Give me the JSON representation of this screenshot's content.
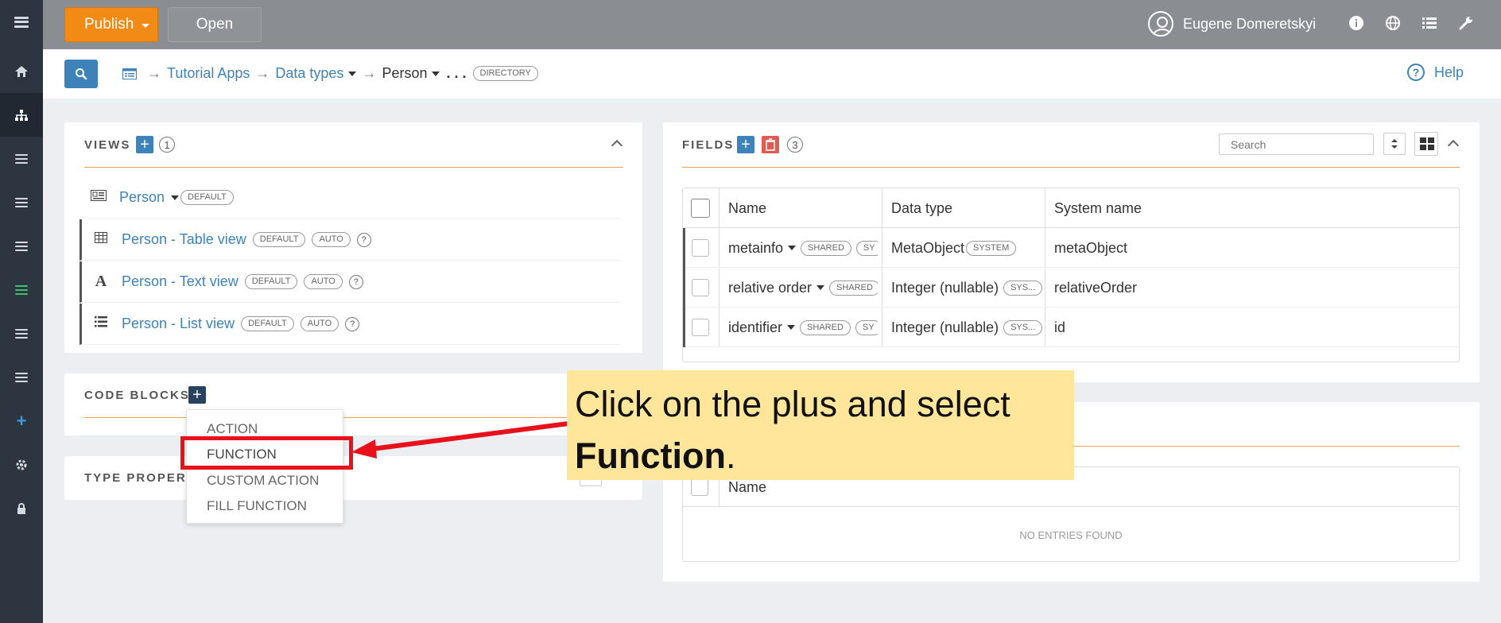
{
  "sidebar": {
    "items": [
      {
        "icon": "menu-icon"
      },
      {
        "icon": "home-icon"
      },
      {
        "icon": "sitemap-icon"
      },
      {
        "icon": "list-icon"
      },
      {
        "icon": "list-icon"
      },
      {
        "icon": "list-icon"
      },
      {
        "icon": "list-icon"
      },
      {
        "icon": "list-icon"
      },
      {
        "icon": "list-icon"
      },
      {
        "icon": "plus-icon"
      },
      {
        "icon": "gear-icon"
      },
      {
        "icon": "lock-icon"
      }
    ]
  },
  "topbar": {
    "publish_label": "Publish",
    "open_label": "Open",
    "user_name": "Eugene Domeretskyi"
  },
  "header": {
    "breadcrumb": {
      "item1": "Tutorial Apps",
      "item2": "Data types",
      "item3": "Person",
      "ellipsis": ". . .",
      "badge": "DIRECTORY"
    },
    "help_label": "Help"
  },
  "views": {
    "title": "VIEWS",
    "count": "1",
    "items": [
      {
        "label": "Person",
        "badges": [
          "DEFAULT"
        ]
      },
      {
        "label": "Person - Table view",
        "badges": [
          "DEFAULT",
          "AUTO"
        ]
      },
      {
        "label": "Person - Text view",
        "badges": [
          "DEFAULT",
          "AUTO"
        ]
      },
      {
        "label": "Person - List view",
        "badges": [
          "DEFAULT",
          "AUTO"
        ]
      }
    ]
  },
  "code_blocks": {
    "title": "CODE BLOCKS"
  },
  "type_properties": {
    "title": "TYPE PROPERT"
  },
  "dropdown": {
    "items": [
      "ACTION",
      "FUNCTION",
      "CUSTOM ACTION",
      "FILL FUNCTION"
    ]
  },
  "fields": {
    "title": "FIELDS",
    "count": "3",
    "search_placeholder": "Search",
    "columns": [
      "Name",
      "Data type",
      "System name"
    ],
    "rows": [
      {
        "name": "metainfo",
        "name_badge": "SHARED",
        "name_badge2": "SY",
        "type": "MetaObject",
        "type_badge": "SYSTEM",
        "system": "metaObject"
      },
      {
        "name": "relative order",
        "name_badge": "SHARED",
        "type": "Integer (nullable)",
        "type_badge": "SYS...",
        "system": "relativeOrder"
      },
      {
        "name": "identifier",
        "name_badge": "SHARED",
        "name_badge2": "SY",
        "type": "Integer (nullable)",
        "type_badge": "SYS...",
        "system": "id"
      }
    ]
  },
  "lower_table": {
    "column": "Name",
    "empty_text": "NO ENTRIES FOUND"
  },
  "callout": {
    "line1": "Click on the plus and select",
    "bold": "Function",
    "end": "."
  },
  "colors": {
    "accent": "#f28a16",
    "link": "#3d82b8",
    "highlight": "#e8101a",
    "callout_bg": "#ffe69a"
  }
}
